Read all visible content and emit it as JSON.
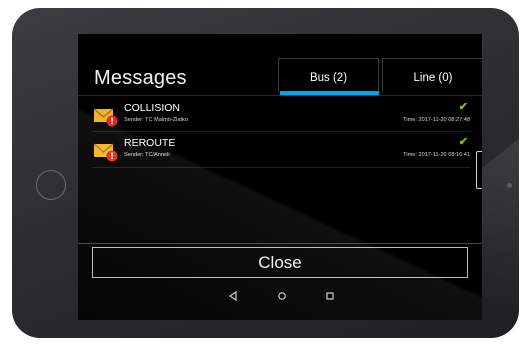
{
  "screen": {
    "title": "Messages"
  },
  "tabs": [
    {
      "label": "Bus (2)",
      "active": true
    },
    {
      "label": "Line (0)",
      "active": false
    }
  ],
  "messages": [
    {
      "title": "COLLISION",
      "sender": "Sender: TC Malmö-Zlatko",
      "time": "Time: 2017-11-20 08:27:48",
      "read": true
    },
    {
      "title": "REROUTE",
      "sender": "Sender: TC/Anneli",
      "time": "Time: 2017-11-20 08:16:41",
      "read": true
    }
  ],
  "close_label": "Close",
  "icons": {
    "message": "envelope-alert-icon",
    "read": "checkmark-icon",
    "nav_back": "back-triangle-icon",
    "nav_home": "home-circle-icon",
    "nav_recent": "recent-apps-square-icon"
  },
  "colors": {
    "accent": "#00a8e8",
    "check": "#7cc21a",
    "envelope": "#f0b428",
    "alert": "#e02a1a"
  }
}
